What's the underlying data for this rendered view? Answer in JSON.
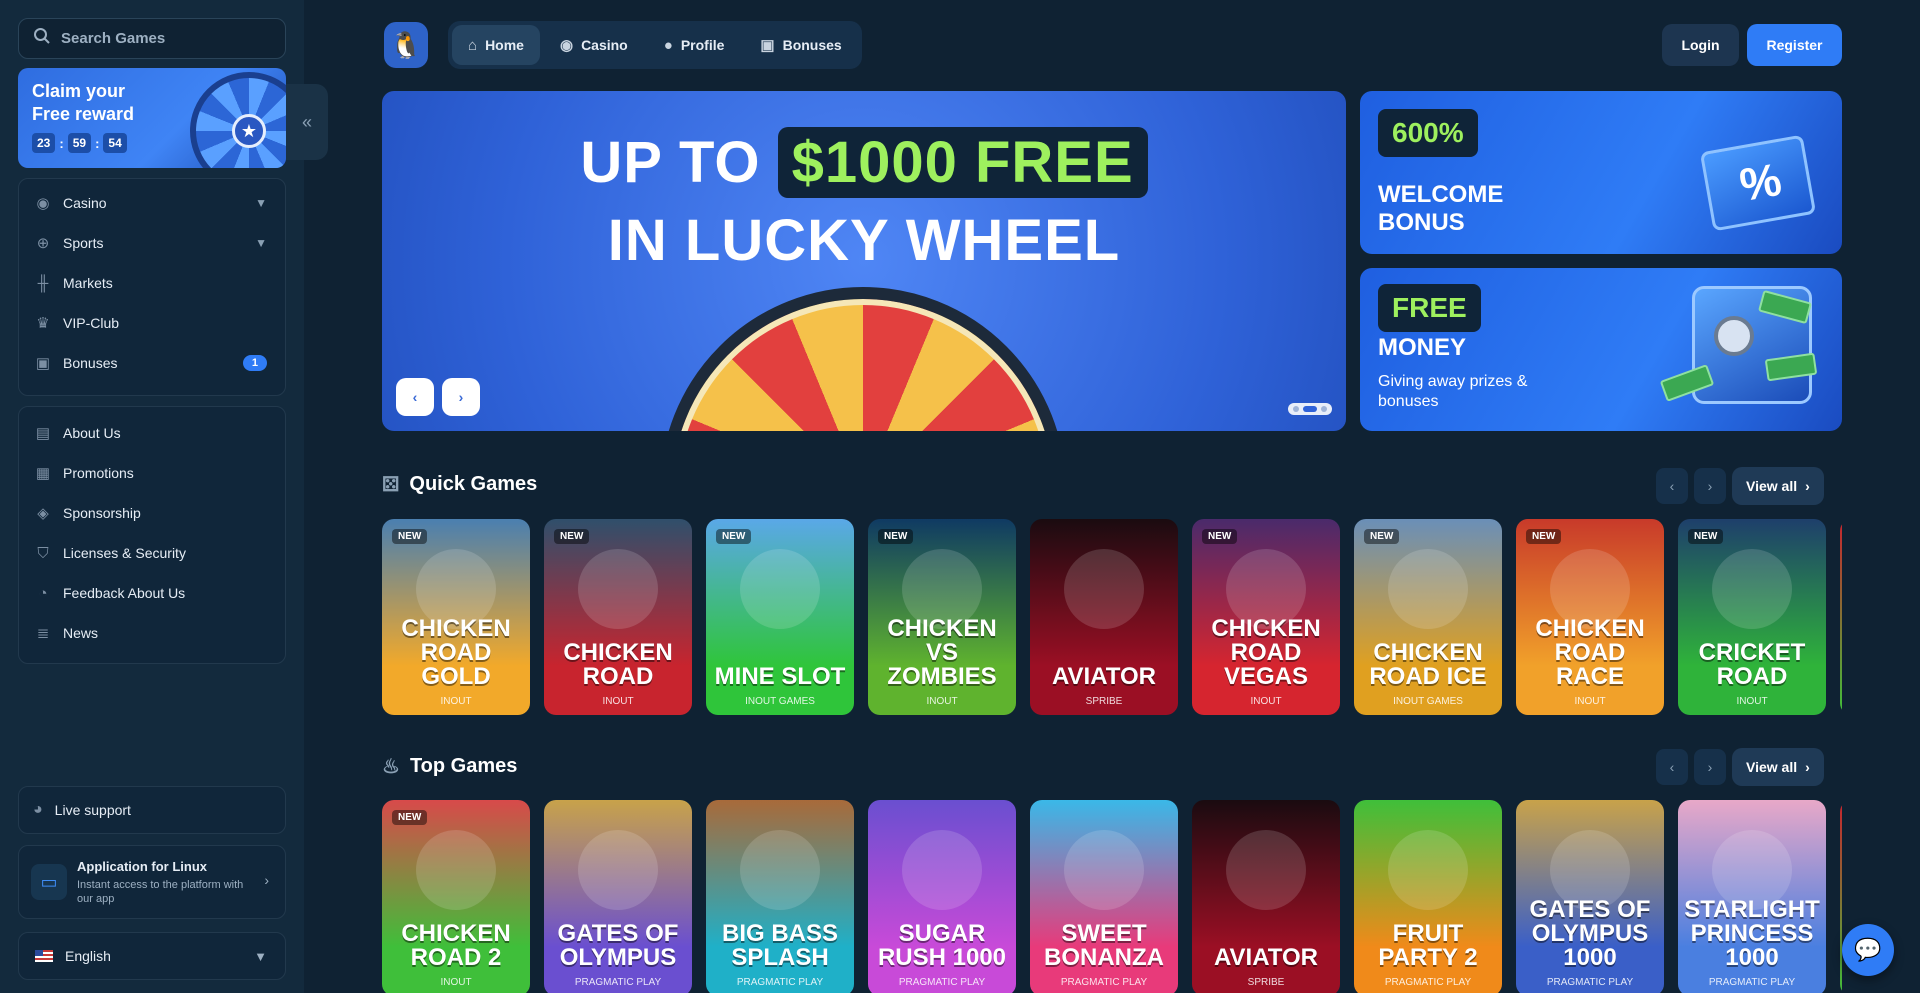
{
  "search": {
    "placeholder": "Search Games"
  },
  "claim": {
    "title": "Claim your Free reward",
    "timer": [
      "23",
      "59",
      "54"
    ]
  },
  "sidebar": {
    "main_items": [
      {
        "label": "Casino",
        "icon": "chip-icon",
        "has_chevron": true
      },
      {
        "label": "Sports",
        "icon": "globe-icon",
        "has_chevron": true
      },
      {
        "label": "Markets",
        "icon": "candles-icon"
      },
      {
        "label": "VIP-Club",
        "icon": "crown-icon"
      },
      {
        "label": "Bonuses",
        "icon": "gift-icon",
        "badge": "1"
      }
    ],
    "info_items": [
      {
        "label": "About Us",
        "icon": "book-icon"
      },
      {
        "label": "Promotions",
        "icon": "ticket-icon"
      },
      {
        "label": "Sponsorship",
        "icon": "medal-icon"
      },
      {
        "label": "Licenses & Security",
        "icon": "shield-icon"
      },
      {
        "label": "Feedback About Us",
        "icon": "chat-icon"
      },
      {
        "label": "News",
        "icon": "newspaper-icon"
      }
    ],
    "live_support": "Live support",
    "app": {
      "title": "Application for Linux",
      "subtitle": "Instant access to the platform with our app"
    },
    "language": "English"
  },
  "header": {
    "tabs": [
      {
        "label": "Home",
        "icon": "home-icon",
        "active": true
      },
      {
        "label": "Casino",
        "icon": "chip-icon"
      },
      {
        "label": "Profile",
        "icon": "user-icon"
      },
      {
        "label": "Bonuses",
        "icon": "gift-icon"
      }
    ],
    "login": "Login",
    "register": "Register"
  },
  "hero": {
    "line1_prefix": "UP TO",
    "line1_highlight": "$1000 FREE",
    "line2": "IN LUCKY WHEEL",
    "slide_index": 2,
    "slide_count": 3
  },
  "promos": [
    {
      "tag": "600%",
      "title": "WELCOME BONUS",
      "subtitle": ""
    },
    {
      "tag": "FREE",
      "title": "MONEY",
      "subtitle": "Giving away prizes & bonuses"
    }
  ],
  "quick_games": {
    "title": "Quick Games",
    "view_all": "View all",
    "items": [
      {
        "name": "CHICKEN ROAD GOLD",
        "provider": "INOUT",
        "new": true,
        "color1": "#f2a92a",
        "color2": "#4a7fb0"
      },
      {
        "name": "CHICKEN ROAD",
        "provider": "INOUT",
        "new": true,
        "color1": "#c8242e",
        "color2": "#2f4f6b"
      },
      {
        "name": "MINE SLOT",
        "provider": "INOUT GAMES",
        "new": true,
        "color1": "#2fc53a",
        "color2": "#5aa8e8"
      },
      {
        "name": "CHICKEN VS ZOMBIES",
        "provider": "INOUT",
        "new": true,
        "color1": "#5fb32e",
        "color2": "#0f3a63"
      },
      {
        "name": "AVIATOR",
        "provider": "SPRIBE",
        "new": false,
        "color1": "#9b0f24",
        "color2": "#1a0b10"
      },
      {
        "name": "CHICKEN ROAD VEGAS",
        "provider": "INOUT",
        "new": true,
        "color1": "#d6252f",
        "color2": "#4a2a6b"
      },
      {
        "name": "CHICKEN ROAD ICE",
        "provider": "INOUT GAMES",
        "new": true,
        "color1": "#e0a020",
        "color2": "#6a8fb8"
      },
      {
        "name": "CHICKEN ROAD RACE",
        "provider": "INOUT",
        "new": true,
        "color1": "#f1a12a",
        "color2": "#c83a2a"
      },
      {
        "name": "CRICKET ROAD",
        "provider": "INOUT",
        "new": true,
        "color1": "#2fb33a",
        "color2": "#1e3f6b"
      }
    ]
  },
  "top_games": {
    "title": "Top Games",
    "view_all": "View all",
    "items": [
      {
        "name": "CHICKEN ROAD 2",
        "provider": "INOUT",
        "new": true,
        "color1": "#3fbf3a",
        "color2": "#d84a4a"
      },
      {
        "name": "GATES OF OLYMPUS",
        "provider": "PRAGMATIC PLAY",
        "new": false,
        "color1": "#6a4fd0",
        "color2": "#c8a24a"
      },
      {
        "name": "BIG BASS SPLASH",
        "provider": "PRAGMATIC PLAY",
        "new": false,
        "color1": "#1fb0c8",
        "color2": "#a86a3a"
      },
      {
        "name": "SUGAR RUSH 1000",
        "provider": "PRAGMATIC PLAY",
        "new": false,
        "color1": "#c84ad8",
        "color2": "#6a4fd0"
      },
      {
        "name": "SWEET BONANZA",
        "provider": "PRAGMATIC PLAY",
        "new": false,
        "color1": "#e83a7a",
        "color2": "#3ab8e8"
      },
      {
        "name": "AVIATOR",
        "provider": "SPRIBE",
        "new": false,
        "color1": "#9b0f24",
        "color2": "#1a0b10"
      },
      {
        "name": "FRUIT PARTY 2",
        "provider": "PRAGMATIC PLAY",
        "new": false,
        "color1": "#f08a1a",
        "color2": "#3fbf3a"
      },
      {
        "name": "GATES OF OLYMPUS 1000",
        "provider": "PRAGMATIC PLAY",
        "new": false,
        "color1": "#3a5fc8",
        "color2": "#c8a24a"
      },
      {
        "name": "STARLIGHT PRINCESS 1000",
        "provider": "PRAGMATIC PLAY",
        "new": false,
        "color1": "#4a7fe0",
        "color2": "#e8a8c8"
      }
    ]
  },
  "colors": {
    "accent": "#2f7cf6",
    "highlight": "#9ef05e",
    "background": "#0f2233",
    "sidebar": "#132a3d"
  }
}
